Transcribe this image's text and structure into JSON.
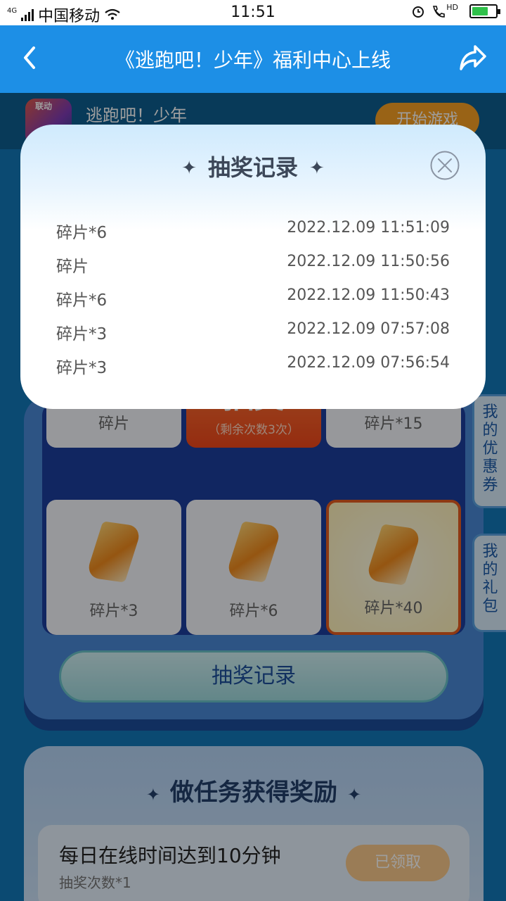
{
  "status_bar": {
    "network": "4G",
    "carrier": "中国移动",
    "time": "11:51",
    "hd": "HD"
  },
  "navbar": {
    "back_icon": "chevron-left-icon",
    "title": "《逃跑吧！少年》福利中心上线",
    "share_icon": "share-icon"
  },
  "game": {
    "logo_tag": "联动",
    "name": "逃跑吧！少年",
    "start_button": "开始游戏"
  },
  "prize_grid": {
    "cells": [
      {
        "label": "碎片"
      },
      {
        "big": "抽奖",
        "sub": "（剩余次数3次）"
      },
      {
        "label": "碎片*15"
      },
      {
        "label": "碎片*3"
      },
      {
        "label": "碎片*6"
      },
      {
        "label": "碎片*40"
      }
    ],
    "record_button": "抽奖记录"
  },
  "side_tabs": {
    "coupons": "我的优惠券",
    "gifts": "我的礼包"
  },
  "tasks": {
    "title": "做任务获得奖励",
    "items": [
      {
        "name": "每日在线时间达到10分钟",
        "reward": "抽奖次数*1",
        "button": "已领取"
      }
    ]
  },
  "modal": {
    "title": "抽奖记录",
    "records": [
      {
        "prize": "碎片*6",
        "time": "2022.12.09 11:51:09"
      },
      {
        "prize": "碎片",
        "time": "2022.12.09 11:50:56"
      },
      {
        "prize": "碎片*6",
        "time": "2022.12.09 11:50:43"
      },
      {
        "prize": "碎片*3",
        "time": "2022.12.09 07:57:08"
      },
      {
        "prize": "碎片*3",
        "time": "2022.12.09 07:56:54"
      }
    ]
  },
  "colors": {
    "nav_blue": "#1d8fe6",
    "draw_orange": "#f0471a",
    "gem_orange": "#f08a1c"
  }
}
